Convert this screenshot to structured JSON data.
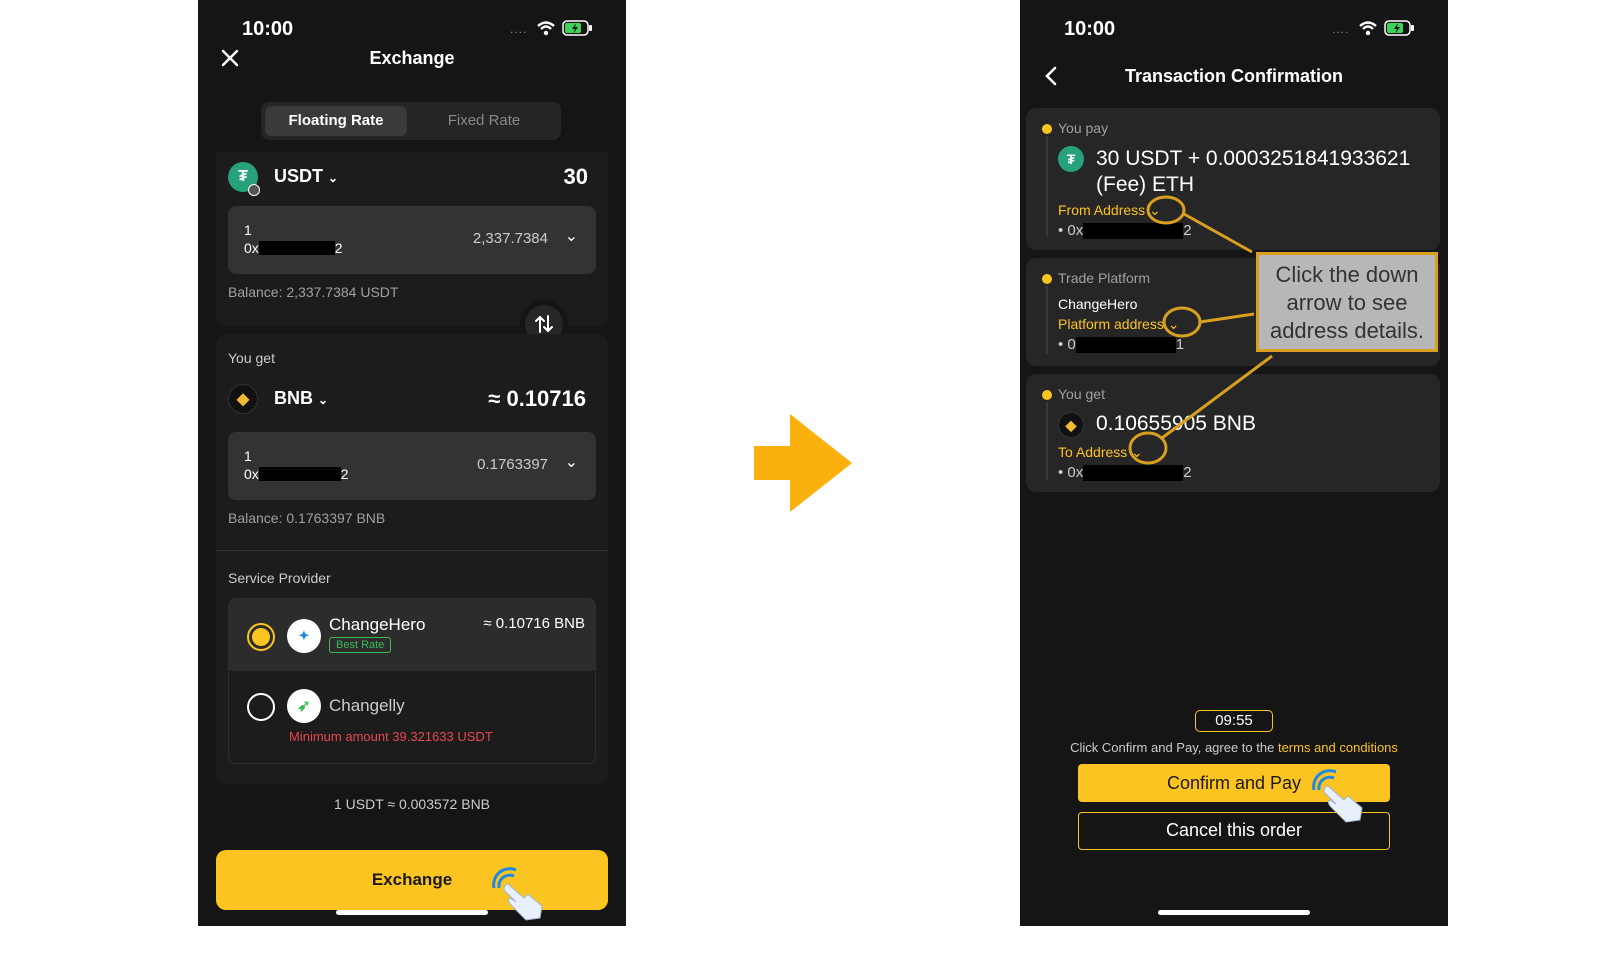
{
  "left": {
    "status_time": "10:00",
    "title": "Exchange",
    "tabs": [
      "Floating Rate",
      "Fixed Rate"
    ],
    "from": {
      "token": "USDT",
      "amount": "30",
      "wallet_name": "1",
      "address_prefix": "0x",
      "address_suffix": "2",
      "wallet_balance": "2,337.7384",
      "balance_text": "Balance: 2,337.7384 USDT"
    },
    "you_get_label": "You get",
    "to": {
      "token": "BNB",
      "amount": "≈ 0.10716",
      "wallet_name": "1",
      "address_prefix": "0x",
      "address_suffix": "2",
      "wallet_balance": "0.1763397",
      "balance_text": "Balance: 0.1763397 BNB"
    },
    "service_provider_label": "Service Provider",
    "providers": [
      {
        "name": "ChangeHero",
        "badge": "Best Rate",
        "rate": "≈ 0.10716 BNB",
        "selected": true
      },
      {
        "name": "Changelly",
        "warning": "Minimum amount 39.321633 USDT",
        "selected": false
      }
    ],
    "rate_line": "1 USDT ≈ 0.003572 BNB",
    "exchange_button": "Exchange"
  },
  "right": {
    "status_time": "10:00",
    "title": "Transaction Confirmation",
    "you_pay_label": "You pay",
    "pay_amount_line1": "30 USDT + 0.0003251841933621",
    "pay_amount_line2": "(Fee) ETH",
    "from_address_label": "From Address",
    "from_prefix": "0x",
    "from_suffix": "2",
    "trade_platform_label": "Trade Platform",
    "platform_name": "ChangeHero",
    "platform_address_label": "Platform address",
    "platform_prefix": "0",
    "platform_suffix": "1",
    "you_get_label": "You get",
    "get_amount": "0.10655905 BNB",
    "to_address_label": "To Address",
    "to_prefix": "0x",
    "to_suffix": "2",
    "timer": "09:55",
    "terms_text": "Click Confirm and Pay, agree to the ",
    "terms_link": "terms and conditions",
    "confirm_button": "Confirm and Pay",
    "cancel_button": "Cancel this order"
  },
  "callout_text": [
    "Click the down",
    "arrow to see",
    "address details."
  ],
  "colors": {
    "accent": "#fcc420",
    "warning": "#e5484d",
    "arrow": "#fbb10d",
    "callout_bg": "#b7b7b7",
    "callout_border": "#d9a020"
  }
}
